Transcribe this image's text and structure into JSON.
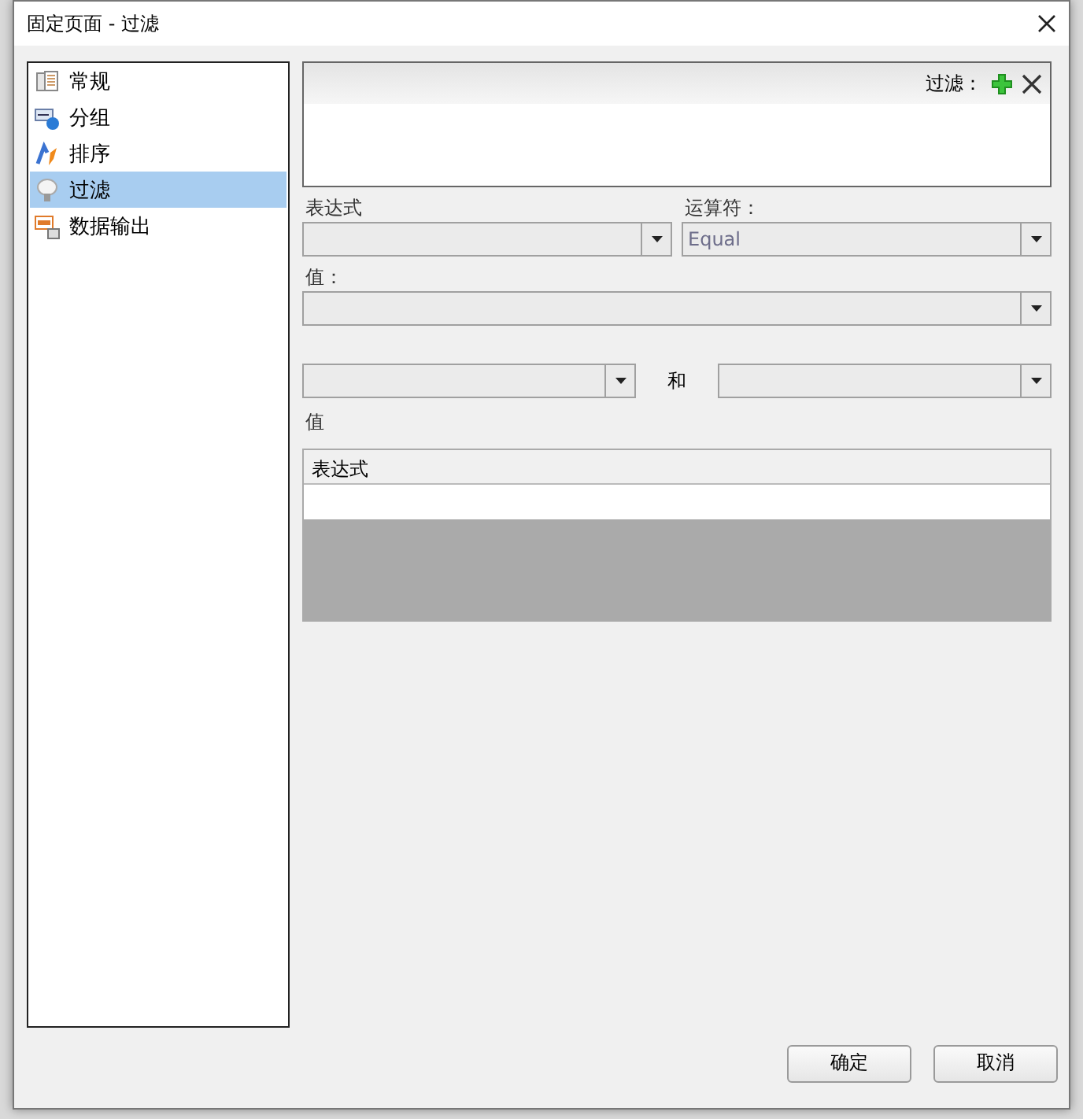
{
  "window": {
    "title": "固定页面 - 过滤"
  },
  "sidebar": {
    "items": [
      {
        "label": "常规",
        "kind": "general",
        "selected": false
      },
      {
        "label": "分组",
        "kind": "group",
        "selected": false
      },
      {
        "label": "排序",
        "kind": "sort",
        "selected": false
      },
      {
        "label": "过滤",
        "kind": "filter",
        "selected": true
      },
      {
        "label": "数据输出",
        "kind": "output",
        "selected": false
      }
    ]
  },
  "filter_list": {
    "title": "过滤："
  },
  "expression": {
    "label": "表达式"
  },
  "operator": {
    "label": "运算符：",
    "value": "Equal"
  },
  "value": {
    "label": "值："
  },
  "range": {
    "conjunction": "和"
  },
  "values": {
    "label": "值",
    "columns": [
      "表达式"
    ]
  },
  "buttons": [
    "确定",
    "取消"
  ]
}
